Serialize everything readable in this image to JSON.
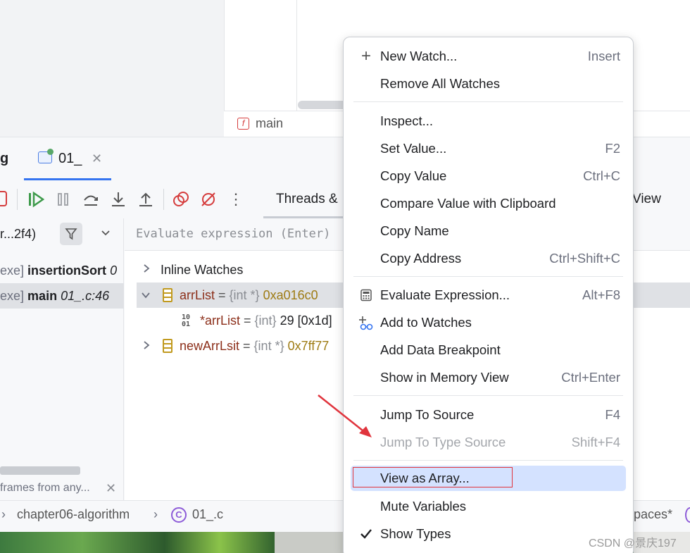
{
  "editor": {
    "frame_icon_letter": "f",
    "frame_name": "main"
  },
  "debug_tabs": {
    "partial_tab": "g",
    "active_tab": "01_"
  },
  "toolbar": {
    "threads_tab": "Threads &",
    "view_tab": "View"
  },
  "frames": {
    "thread_selector": "r...2f4)",
    "rows": [
      {
        "prefix": "exe]",
        "function": "insertionSort",
        "location": "0"
      },
      {
        "prefix": "exe]",
        "function": "main",
        "location": "01_.c:46"
      }
    ],
    "hint": "frames from any..."
  },
  "variables": {
    "evaluate_placeholder": "Evaluate expression (Enter)",
    "inline_watches": "Inline Watches",
    "rows": [
      {
        "name": "arrList",
        "eq": " = ",
        "type": "{int *}",
        "value": " 0xa016c0"
      },
      {
        "name": "*arrList",
        "eq": " = ",
        "type": "{int}",
        "value": " 29 [0x1d]"
      },
      {
        "name": "newArrLsit",
        "eq": " = ",
        "type": "{int *}",
        "value": " 0x7ff77"
      }
    ],
    "bits_icon_top": "10",
    "bits_icon_bottom": "01"
  },
  "breadcrumb": {
    "folder": "chapter06-algorithm",
    "file_icon_letter": "C",
    "file": "01_.c",
    "right_partial": "paces*"
  },
  "watermark": "CSDN @景庆197",
  "context_menu": {
    "items": [
      {
        "label": "New Watch...",
        "shortcut": "Insert",
        "icon": "plus-icon",
        "disabled": false
      },
      {
        "label": "Remove All Watches",
        "shortcut": "",
        "disabled": false
      },
      {
        "label": "Inspect...",
        "shortcut": "",
        "disabled": false
      },
      {
        "label": "Set Value...",
        "shortcut": "F2",
        "disabled": false
      },
      {
        "label": "Copy Value",
        "shortcut": "Ctrl+C",
        "disabled": false
      },
      {
        "label": "Compare Value with Clipboard",
        "shortcut": "",
        "disabled": false
      },
      {
        "label": "Copy Name",
        "shortcut": "",
        "disabled": false
      },
      {
        "label": "Copy Address",
        "shortcut": "Ctrl+Shift+C",
        "disabled": false
      },
      {
        "label": "Evaluate Expression...",
        "shortcut": "Alt+F8",
        "icon": "calculator-icon",
        "disabled": false
      },
      {
        "label": "Add to Watches",
        "shortcut": "",
        "icon": "glasses-icon",
        "disabled": false
      },
      {
        "label": "Add Data Breakpoint",
        "shortcut": "",
        "disabled": false
      },
      {
        "label": "Show in Memory View",
        "shortcut": "Ctrl+Enter",
        "disabled": false
      },
      {
        "label": "Jump To Source",
        "shortcut": "F4",
        "disabled": false
      },
      {
        "label": "Jump To Type Source",
        "shortcut": "Shift+F4",
        "disabled": true
      },
      {
        "label": "View as Array...",
        "shortcut": "",
        "disabled": false,
        "highlighted": true
      },
      {
        "label": "Mute Variables",
        "shortcut": "",
        "disabled": false
      },
      {
        "label": "Show Types",
        "shortcut": "",
        "icon": "checkmark-icon",
        "checked": true,
        "disabled": false
      }
    ]
  },
  "colors": {
    "accent": "#3574f0",
    "menu_highlight": "#d4e2ff",
    "annotation_red": "#e0343d",
    "variable_name": "#8c2f1a",
    "variable_value": "#9e7b13"
  }
}
